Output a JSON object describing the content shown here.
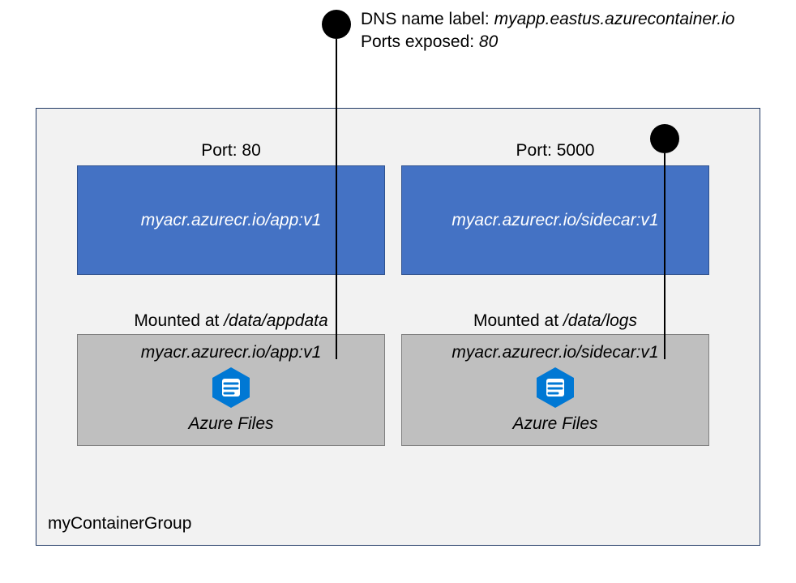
{
  "header": {
    "dns_label_text": "DNS name label: ",
    "dns_label_value": "myapp.eastus.azurecontainer.io",
    "ports_label_text": "Ports exposed: ",
    "ports_value": "80"
  },
  "group": {
    "name": "myContainerGroup"
  },
  "containers": [
    {
      "port_label": "Port: 80",
      "image": "myacr.azurecr.io/app:v1",
      "mount_prefix": "Mounted at ",
      "mount_path": "/data/appdata",
      "files_title": "myacr.azurecr.io/app:v1",
      "files_caption": "Azure Files"
    },
    {
      "port_label": "Port: 5000",
      "image": "myacr.azurecr.io/sidecar:v1",
      "mount_prefix": "Mounted at ",
      "mount_path": "/data/logs",
      "files_title": "myacr.azurecr.io/sidecar:v1",
      "files_caption": "Azure Files"
    }
  ]
}
